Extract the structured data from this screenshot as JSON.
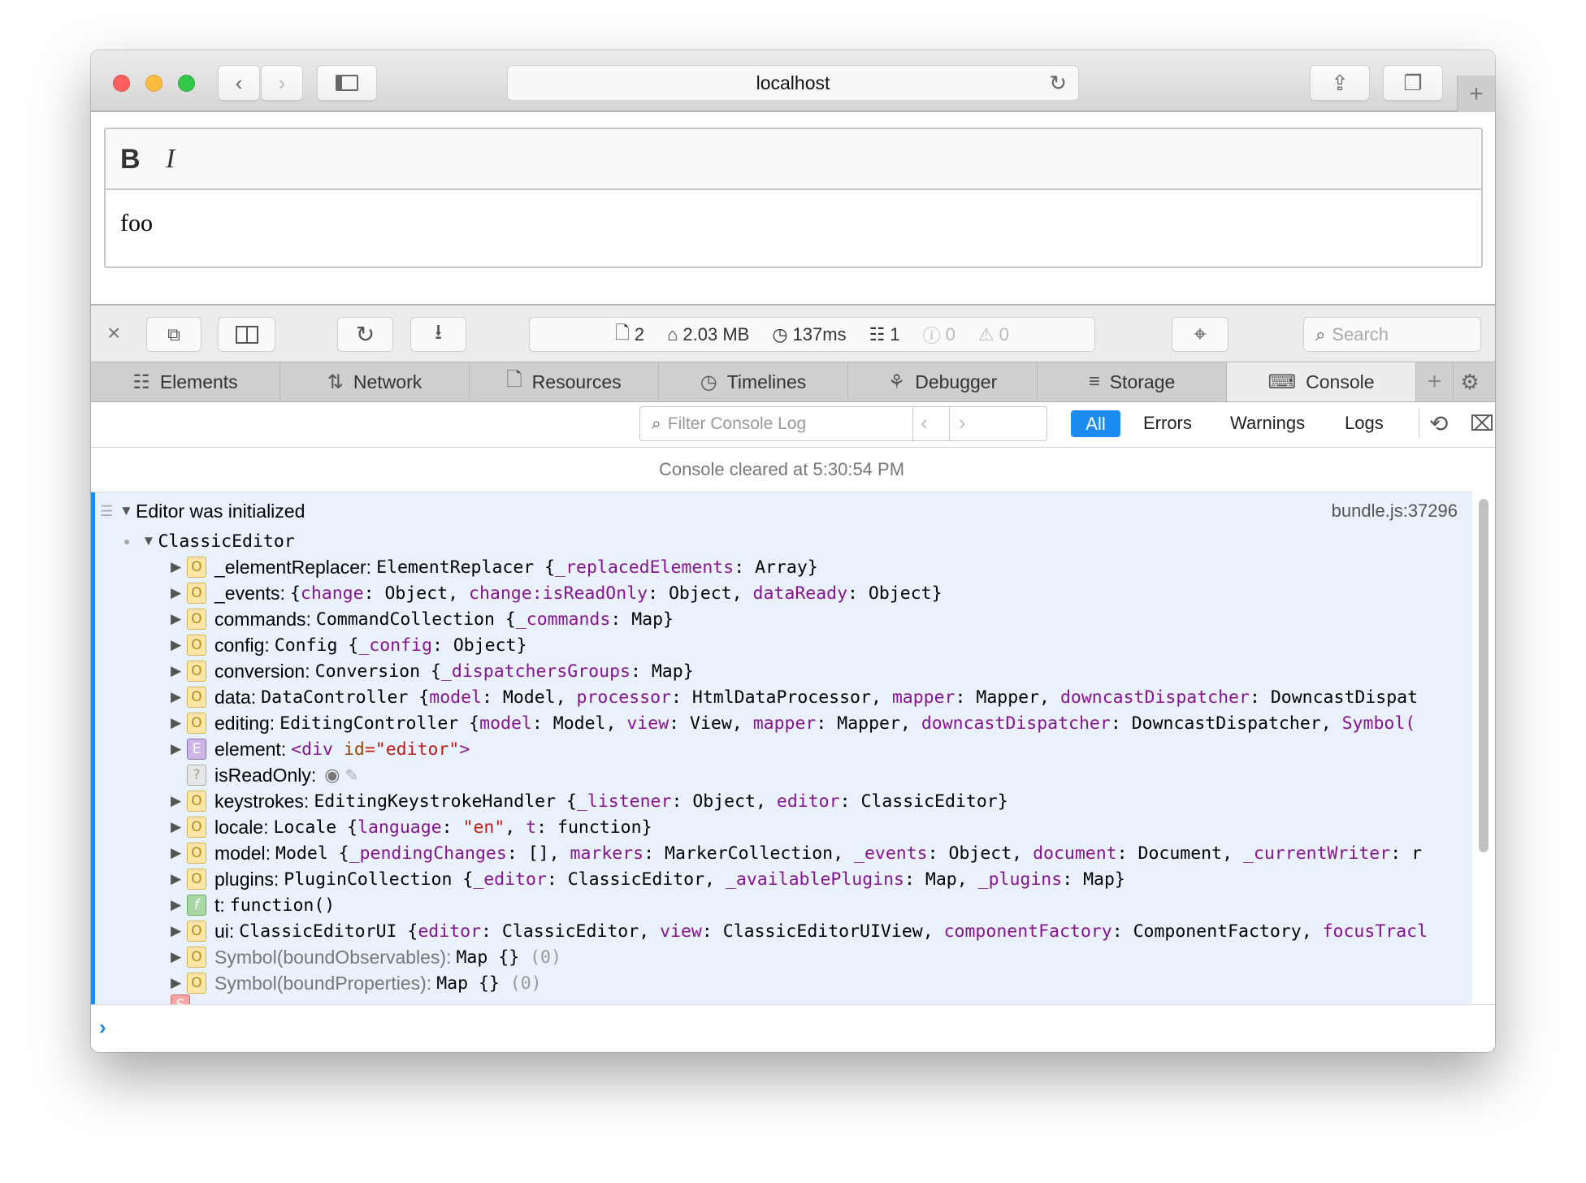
{
  "window": {
    "url": "localhost",
    "colors": {
      "close": "#fc605c",
      "minimize": "#fdbc40",
      "maximize": "#34c84a",
      "accent": "#1c8bf2"
    }
  },
  "editor": {
    "bold_label": "B",
    "italic_label": "I",
    "content": "foo"
  },
  "devtools": {
    "stats": {
      "resources": "2",
      "size": "2.03 MB",
      "time": "137ms",
      "logs": "1",
      "errors": "0",
      "warnings": "0"
    },
    "search_placeholder": "Search",
    "tabs": [
      {
        "label": "Elements",
        "icon": "elements-icon"
      },
      {
        "label": "Network",
        "icon": "network-icon"
      },
      {
        "label": "Resources",
        "icon": "resources-icon"
      },
      {
        "label": "Timelines",
        "icon": "timelines-icon"
      },
      {
        "label": "Debugger",
        "icon": "debugger-icon"
      },
      {
        "label": "Storage",
        "icon": "storage-icon"
      },
      {
        "label": "Console",
        "icon": "console-icon",
        "active": true
      }
    ],
    "filter": {
      "placeholder": "Filter Console Log",
      "levels": [
        "All",
        "Errors",
        "Warnings",
        "Logs"
      ],
      "selected": "All"
    }
  },
  "console": {
    "cleared": "Console cleared at 5:30:54 PM",
    "group": {
      "message": "Editor was initialized",
      "source": "bundle.js:37296",
      "object": "ClassicEditor",
      "rows": [
        {
          "icon": "o",
          "name": "_elementReplacer:",
          "segments": [
            {
              "t": "ElementReplacer {",
              "c": "p"
            },
            {
              "t": "_replacedElements",
              "c": "k"
            },
            {
              "t": ": Array}",
              "c": "p"
            }
          ]
        },
        {
          "icon": "o",
          "name": "_events:",
          "segments": [
            {
              "t": "{",
              "c": "p"
            },
            {
              "t": "change",
              "c": "k"
            },
            {
              "t": ": Object, ",
              "c": "p"
            },
            {
              "t": "change:isReadOnly",
              "c": "k"
            },
            {
              "t": ": Object, ",
              "c": "p"
            },
            {
              "t": "dataReady",
              "c": "k"
            },
            {
              "t": ": Object}",
              "c": "p"
            }
          ]
        },
        {
          "icon": "o",
          "name": "commands:",
          "segments": [
            {
              "t": "CommandCollection {",
              "c": "p"
            },
            {
              "t": "_commands",
              "c": "k"
            },
            {
              "t": ": Map}",
              "c": "p"
            }
          ]
        },
        {
          "icon": "o",
          "name": "config:",
          "segments": [
            {
              "t": "Config {",
              "c": "p"
            },
            {
              "t": "_config",
              "c": "k"
            },
            {
              "t": ": Object}",
              "c": "p"
            }
          ]
        },
        {
          "icon": "o",
          "name": "conversion:",
          "segments": [
            {
              "t": "Conversion {",
              "c": "p"
            },
            {
              "t": "_dispatchersGroups",
              "c": "k"
            },
            {
              "t": ": Map}",
              "c": "p"
            }
          ]
        },
        {
          "icon": "o",
          "name": "data:",
          "segments": [
            {
              "t": "DataController {",
              "c": "p"
            },
            {
              "t": "model",
              "c": "k"
            },
            {
              "t": ": Model, ",
              "c": "p"
            },
            {
              "t": "processor",
              "c": "k"
            },
            {
              "t": ": HtmlDataProcessor, ",
              "c": "p"
            },
            {
              "t": "mapper",
              "c": "k"
            },
            {
              "t": ": Mapper, ",
              "c": "p"
            },
            {
              "t": "downcastDispatcher",
              "c": "k"
            },
            {
              "t": ": DowncastDispat",
              "c": "p"
            }
          ]
        },
        {
          "icon": "o",
          "name": "editing:",
          "segments": [
            {
              "t": "EditingController {",
              "c": "p"
            },
            {
              "t": "model",
              "c": "k"
            },
            {
              "t": ": Model, ",
              "c": "p"
            },
            {
              "t": "view",
              "c": "k"
            },
            {
              "t": ": View, ",
              "c": "p"
            },
            {
              "t": "mapper",
              "c": "k"
            },
            {
              "t": ": Mapper, ",
              "c": "p"
            },
            {
              "t": "downcastDispatcher",
              "c": "k"
            },
            {
              "t": ": DowncastDispatcher, ",
              "c": "p"
            },
            {
              "t": "Symbol(",
              "c": "k"
            }
          ]
        },
        {
          "icon": "e",
          "name": "element:",
          "segments": [
            {
              "t": "<div ",
              "c": "t"
            },
            {
              "t": "id",
              "c": "a"
            },
            {
              "t": "=\"editor\"",
              "c": "s"
            },
            {
              "t": ">",
              "c": "t"
            }
          ]
        },
        {
          "icon": "u",
          "name": "isReadOnly:",
          "getter": true,
          "segments": []
        },
        {
          "icon": "o",
          "name": "keystrokes:",
          "segments": [
            {
              "t": "EditingKeystrokeHandler {",
              "c": "p"
            },
            {
              "t": "_listener",
              "c": "k"
            },
            {
              "t": ": Object, ",
              "c": "p"
            },
            {
              "t": "editor",
              "c": "k"
            },
            {
              "t": ": ClassicEditor}",
              "c": "p"
            }
          ]
        },
        {
          "icon": "o",
          "name": "locale:",
          "segments": [
            {
              "t": "Locale {",
              "c": "p"
            },
            {
              "t": "language",
              "c": "k"
            },
            {
              "t": ": ",
              "c": "p"
            },
            {
              "t": "\"en\"",
              "c": "s"
            },
            {
              "t": ", ",
              "c": "p"
            },
            {
              "t": "t",
              "c": "k"
            },
            {
              "t": ": function}",
              "c": "p"
            }
          ]
        },
        {
          "icon": "o",
          "name": "model:",
          "segments": [
            {
              "t": "Model {",
              "c": "p"
            },
            {
              "t": "_pendingChanges",
              "c": "k"
            },
            {
              "t": ": [], ",
              "c": "p"
            },
            {
              "t": "markers",
              "c": "k"
            },
            {
              "t": ": MarkerCollection, ",
              "c": "p"
            },
            {
              "t": "_events",
              "c": "k"
            },
            {
              "t": ": Object, ",
              "c": "p"
            },
            {
              "t": "document",
              "c": "k"
            },
            {
              "t": ": Document, ",
              "c": "p"
            },
            {
              "t": "_currentWriter",
              "c": "k"
            },
            {
              "t": ": r",
              "c": "p"
            }
          ]
        },
        {
          "icon": "o",
          "name": "plugins:",
          "segments": [
            {
              "t": "PluginCollection {",
              "c": "p"
            },
            {
              "t": "_editor",
              "c": "k"
            },
            {
              "t": ": ClassicEditor, ",
              "c": "p"
            },
            {
              "t": "_availablePlugins",
              "c": "k"
            },
            {
              "t": ": Map, ",
              "c": "p"
            },
            {
              "t": "_plugins",
              "c": "k"
            },
            {
              "t": ": Map}",
              "c": "p"
            }
          ]
        },
        {
          "icon": "f",
          "name": "t:",
          "segments": [
            {
              "t": "function()",
              "c": "p"
            }
          ]
        },
        {
          "icon": "o",
          "name": "ui:",
          "segments": [
            {
              "t": "ClassicEditorUI {",
              "c": "p"
            },
            {
              "t": "editor",
              "c": "k"
            },
            {
              "t": ": ClassicEditor, ",
              "c": "p"
            },
            {
              "t": "view",
              "c": "k"
            },
            {
              "t": ": ClassicEditorUIView, ",
              "c": "p"
            },
            {
              "t": "componentFactory",
              "c": "k"
            },
            {
              "t": ": ComponentFactory, ",
              "c": "p"
            },
            {
              "t": "focusTracl",
              "c": "k"
            }
          ]
        },
        {
          "icon": "o",
          "name": "Symbol(boundObservables):",
          "dim": true,
          "segments": [
            {
              "t": "Map {} ",
              "c": "p"
            },
            {
              "t": "(0)",
              "c": "d"
            }
          ]
        },
        {
          "icon": "o",
          "name": "Symbol(boundProperties):",
          "dim": true,
          "segments": [
            {
              "t": "Map {} ",
              "c": "p"
            },
            {
              "t": "(0)",
              "c": "d"
            }
          ]
        }
      ]
    }
  }
}
